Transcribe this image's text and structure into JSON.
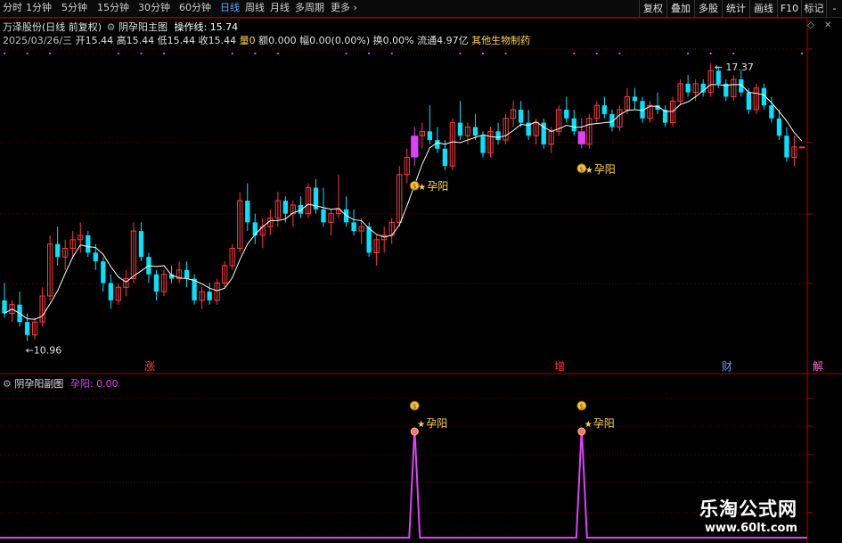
{
  "toolbar": {
    "tabs": [
      "分时",
      "1分钟",
      "5分钟",
      "15分钟",
      "30分钟",
      "60分钟",
      "日线",
      "周线",
      "月线",
      "多周期",
      "更多"
    ],
    "active_tab": "日线",
    "right_buttons": [
      "复权",
      "叠加",
      "多股",
      "统计",
      "画线",
      "F10",
      "标记",
      "-"
    ]
  },
  "header": {
    "stock_name": "万泽股份(日线 前复权)",
    "indicator_name": "阴孕阳主图",
    "operation_line_label": "操作线:",
    "operation_line_value": "15.74",
    "date": "2025/03/26/三",
    "open": "开15.44",
    "high": "高15.44",
    "low": "低15.44",
    "close": "收15.44",
    "volume_label": "量",
    "volume_value": "0",
    "amount": "额0.000",
    "change": "幅0.00(0.00%)",
    "turnover": "换0.00%",
    "float": "流通4.97亿",
    "industry": "其他生物制药"
  },
  "main_chart": {
    "high_label": "17.37",
    "low_label": "10.96",
    "signal_label": "孕阳",
    "bottom_markers": [
      "涨",
      "增",
      "财",
      "解"
    ]
  },
  "sub_chart": {
    "title": "阴孕阳副图",
    "value_label": "孕阳: 0.00",
    "signal_label": "孕阳"
  },
  "watermark": {
    "title": "乐淘公式网",
    "url": "www.60lt.com"
  },
  "colors": {
    "up": "#ff3b3b",
    "down": "#00e5ff",
    "signal": "#e040fb",
    "ma": "#ffffff",
    "grid": "#6e0000"
  },
  "chart_data": {
    "type": "candlestick",
    "ohlc": [
      [
        11.9,
        12.3,
        11.5,
        11.6
      ],
      [
        11.6,
        11.9,
        11.4,
        11.8
      ],
      [
        11.8,
        12.1,
        11.3,
        11.4
      ],
      [
        11.4,
        11.6,
        10.96,
        11.1
      ],
      [
        11.1,
        11.5,
        11.0,
        11.4
      ],
      [
        11.4,
        12.2,
        11.3,
        12.0
      ],
      [
        12.0,
        13.4,
        11.9,
        13.2
      ],
      [
        13.2,
        13.6,
        12.7,
        12.9
      ],
      [
        12.9,
        13.3,
        12.6,
        13.1
      ],
      [
        13.1,
        13.5,
        12.9,
        13.3
      ],
      [
        13.3,
        13.7,
        13.0,
        13.4
      ],
      [
        13.4,
        13.5,
        12.9,
        13.0
      ],
      [
        13.0,
        13.2,
        12.6,
        12.8
      ],
      [
        12.8,
        12.9,
        12.1,
        12.3
      ],
      [
        12.3,
        12.5,
        11.7,
        11.9
      ],
      [
        11.9,
        12.3,
        11.8,
        12.2
      ],
      [
        12.2,
        12.6,
        12.0,
        12.4
      ],
      [
        12.4,
        13.7,
        12.3,
        13.5
      ],
      [
        13.5,
        13.7,
        12.8,
        12.9
      ],
      [
        12.9,
        13.0,
        12.3,
        12.5
      ],
      [
        12.5,
        12.6,
        11.9,
        12.1
      ],
      [
        12.1,
        12.6,
        12.0,
        12.5
      ],
      [
        12.5,
        12.7,
        12.3,
        12.4
      ],
      [
        12.4,
        12.8,
        12.3,
        12.6
      ],
      [
        12.6,
        12.8,
        12.2,
        12.4
      ],
      [
        12.4,
        12.5,
        11.8,
        11.9
      ],
      [
        11.9,
        12.2,
        11.7,
        12.1
      ],
      [
        12.1,
        12.3,
        11.8,
        11.9
      ],
      [
        11.9,
        12.4,
        11.8,
        12.3
      ],
      [
        12.3,
        12.8,
        12.2,
        12.7
      ],
      [
        12.7,
        13.2,
        12.6,
        13.1
      ],
      [
        13.1,
        14.4,
        13.0,
        14.2
      ],
      [
        14.2,
        14.6,
        13.5,
        13.7
      ],
      [
        13.7,
        13.9,
        13.2,
        13.4
      ],
      [
        13.4,
        13.8,
        13.1,
        13.6
      ],
      [
        13.6,
        14.0,
        13.4,
        13.8
      ],
      [
        13.8,
        14.4,
        13.6,
        14.2
      ],
      [
        14.2,
        14.3,
        13.7,
        13.9
      ],
      [
        13.9,
        14.2,
        13.6,
        14.1
      ],
      [
        14.1,
        14.3,
        13.8,
        13.9
      ],
      [
        13.9,
        14.6,
        13.8,
        14.5
      ],
      [
        14.5,
        14.7,
        13.9,
        14.0
      ],
      [
        14.0,
        14.5,
        13.6,
        13.7
      ],
      [
        13.7,
        14.0,
        13.4,
        13.9
      ],
      [
        13.9,
        14.8,
        13.8,
        14.0
      ],
      [
        14.0,
        14.3,
        13.6,
        13.7
      ],
      [
        13.7,
        14.0,
        13.4,
        13.5
      ],
      [
        13.5,
        13.8,
        13.2,
        13.6
      ],
      [
        13.6,
        13.7,
        12.9,
        13.0
      ],
      [
        13.0,
        13.4,
        12.7,
        13.3
      ],
      [
        13.3,
        13.6,
        13.0,
        13.4
      ],
      [
        13.4,
        13.8,
        13.2,
        13.7
      ],
      [
        13.7,
        15.0,
        13.6,
        14.8
      ],
      [
        14.8,
        15.4,
        14.6,
        15.2
      ],
      [
        15.2,
        15.9,
        15.0,
        15.7
      ],
      [
        15.7,
        16.0,
        15.4,
        15.8
      ],
      [
        15.8,
        16.4,
        15.5,
        15.6
      ],
      [
        15.6,
        15.9,
        15.3,
        15.4
      ],
      [
        15.4,
        15.6,
        14.9,
        15.0
      ],
      [
        15.0,
        16.1,
        14.9,
        16.0
      ],
      [
        16.0,
        16.5,
        15.6,
        15.7
      ],
      [
        15.7,
        16.0,
        15.5,
        15.9
      ],
      [
        15.9,
        16.2,
        15.6,
        15.7
      ],
      [
        15.7,
        15.8,
        15.2,
        15.3
      ],
      [
        15.3,
        15.9,
        15.2,
        15.8
      ],
      [
        15.8,
        16.0,
        15.5,
        15.6
      ],
      [
        15.6,
        16.2,
        15.5,
        16.1
      ],
      [
        16.1,
        16.5,
        15.9,
        16.3
      ],
      [
        16.3,
        16.5,
        15.9,
        16.0
      ],
      [
        16.0,
        16.3,
        15.6,
        15.7
      ],
      [
        15.7,
        16.1,
        15.5,
        16.0
      ],
      [
        16.0,
        16.1,
        15.4,
        15.5
      ],
      [
        15.5,
        15.9,
        15.3,
        15.8
      ],
      [
        15.8,
        16.4,
        15.7,
        16.3
      ],
      [
        16.3,
        16.6,
        16.0,
        16.1
      ],
      [
        16.1,
        16.3,
        15.7,
        15.8
      ],
      [
        15.8,
        16.1,
        15.4,
        15.5
      ],
      [
        15.5,
        16.2,
        15.4,
        16.1
      ],
      [
        16.1,
        16.5,
        16.0,
        16.4
      ],
      [
        16.4,
        16.6,
        16.1,
        16.2
      ],
      [
        16.2,
        16.3,
        15.8,
        15.9
      ],
      [
        15.9,
        16.4,
        15.8,
        16.3
      ],
      [
        16.3,
        16.8,
        16.2,
        16.6
      ],
      [
        16.6,
        16.8,
        16.3,
        16.5
      ],
      [
        16.5,
        16.6,
        16.0,
        16.1
      ],
      [
        16.1,
        16.5,
        16.0,
        16.4
      ],
      [
        16.4,
        16.7,
        16.2,
        16.3
      ],
      [
        16.3,
        16.4,
        15.9,
        16.0
      ],
      [
        16.0,
        16.6,
        15.9,
        16.5
      ],
      [
        16.5,
        17.0,
        16.4,
        16.9
      ],
      [
        16.9,
        17.1,
        16.6,
        16.7
      ],
      [
        16.7,
        17.0,
        16.5,
        16.9
      ],
      [
        16.9,
        17.0,
        16.6,
        16.7
      ],
      [
        16.7,
        17.37,
        16.6,
        17.2
      ],
      [
        17.2,
        17.3,
        16.8,
        16.9
      ],
      [
        16.9,
        17.0,
        16.5,
        16.6
      ],
      [
        16.6,
        17.1,
        16.5,
        17.0
      ],
      [
        17.0,
        17.2,
        16.6,
        16.7
      ],
      [
        16.7,
        16.8,
        16.2,
        16.3
      ],
      [
        16.3,
        16.9,
        16.2,
        16.8
      ],
      [
        16.8,
        16.9,
        16.3,
        16.4
      ],
      [
        16.4,
        16.6,
        16.0,
        16.1
      ],
      [
        16.1,
        16.3,
        15.6,
        15.7
      ],
      [
        15.7,
        15.9,
        15.1,
        15.2
      ],
      [
        15.2,
        15.7,
        15.0,
        15.44
      ],
      [
        15.44,
        15.44,
        15.44,
        15.44
      ]
    ],
    "signal_indices": [
      54,
      76
    ],
    "bottom_marker_indices": [
      19,
      73,
      95,
      107
    ],
    "ylim": [
      10.6,
      17.7
    ]
  }
}
